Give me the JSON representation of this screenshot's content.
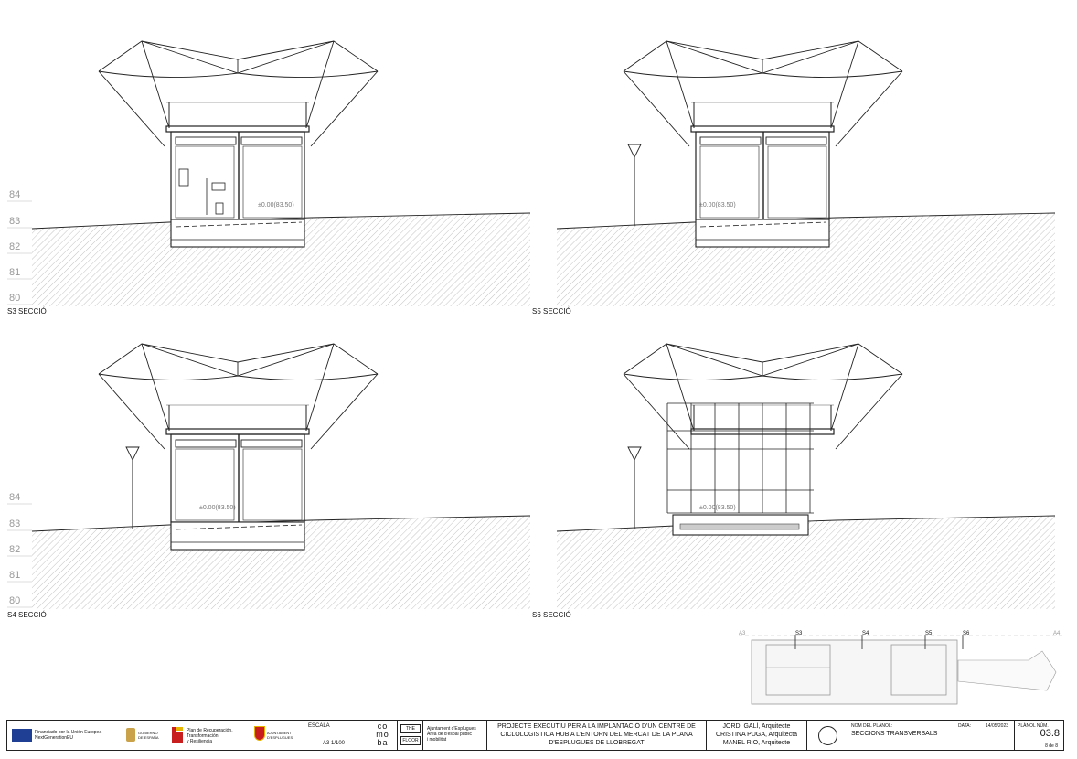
{
  "sections": [
    {
      "label": "S3 SECCIÓ",
      "level_label": "±0.00(83.50)",
      "show_elevations": true
    },
    {
      "label": "S5 SECCIÓ",
      "level_label": "±0.00(83.50)",
      "show_elevations": false
    },
    {
      "label": "S4 SECCIÓ",
      "level_label": "±0.00(83.50)",
      "show_elevations": true
    },
    {
      "label": "S6 SECCIÓ",
      "level_label": "±0.00(83.50)",
      "show_elevations": false
    }
  ],
  "elevations": [
    "84",
    "83",
    "82",
    "81",
    "80"
  ],
  "key_plan": {
    "markers": [
      "S3",
      "S4",
      "S5",
      "S6"
    ],
    "edge_left": "A3",
    "edge_right": "A4"
  },
  "title_block": {
    "funding": {
      "eu_line1": "Financiado por la Unión Europea",
      "eu_line2": "NextGenerationEU",
      "gov_line1": "GOBIERNO",
      "gov_line2": "DE ESPAÑA",
      "plan_line1": "Plan de Recuperación,",
      "plan_line2": "Transformación",
      "plan_line3": "y Resiliencia",
      "city_line1": "AJUNTAMENT",
      "city_line2": "D'ESPLUGUES"
    },
    "escala_label": "ESCALA",
    "escala_value": "A3 1/100",
    "logo_co": "co",
    "logo_mo": "mo",
    "logo_ba": "ba",
    "the_label": "THE",
    "floor_label": "FLOOR",
    "client_line1": "Ajuntament d'Esplugues",
    "client_line2": "Àrea de d'espai públic",
    "client_line3": "i mobilitat",
    "project_line1": "PROJECTE EXECUTIU PER A LA IMPLANTACIÓ D'UN CENTRE DE",
    "project_line2": "CICLOLOGISTICA HUB  A L'ENTORN DEL MERCAT DE LA PLANA",
    "project_line3": "D'ESPLUGUES DE LLOBREGAT",
    "architects": [
      "JORDI GALÍ, Arquitecte",
      "CRISTINA PUGA, Arquitecta",
      "MANEL RIO, Arquitecte"
    ],
    "plan_name_label": "NOM DEL PLÀNOL:",
    "plan_name": "SECCIONS TRANSVERSALS",
    "date_label": "DATA:",
    "date": "14/05/2023",
    "plan_num_label": "PLÀNOL NÚM.",
    "plan_num": "03.8",
    "page": "8 de 8"
  }
}
